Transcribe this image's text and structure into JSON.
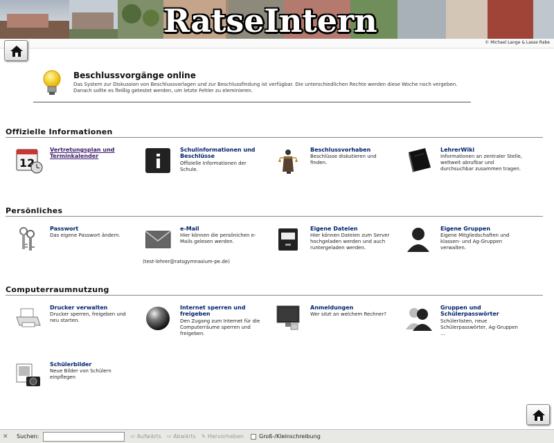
{
  "banner": {
    "title": "RatseIntern",
    "copyright": "© Michael Lange & Lasse Rabe"
  },
  "announcement": {
    "title": "Beschlussvorgänge online",
    "text_1": "Das System zur Diskussion von Beschlussvorlagen und zur Beschlussfindung ist verfügbar. Die unterschiedlichen Rechte werden diese Woche noch vergeben.",
    "text_2": "Danach sollte es fleißig getestet werden, um letzte Fehler zu eleminieren."
  },
  "sections": {
    "official": {
      "title": "Offizielle Informationen",
      "items": [
        {
          "name": "Vertretungsplan und Terminkalender",
          "desc": "",
          "icon": "calendar-icon"
        },
        {
          "name": "Schulinformationen und Beschlüsse",
          "desc": "Offizielle Informationen der Schule.",
          "icon": "info-icon"
        },
        {
          "name": "Beschlussvorhaben",
          "desc": "Beschlüsse diskutieren und finden.",
          "icon": "justitia-icon"
        },
        {
          "name": "LehrerWiki",
          "desc": "Informationen an zentraler Stelle, weltweit abrufbar und durchsuchbar zusammen tragen.",
          "icon": "book-icon"
        }
      ]
    },
    "personal": {
      "title": "Persönliches",
      "items": [
        {
          "name": "Passwort",
          "desc": "Das eigene Passwort ändern.",
          "icon": "keys-icon"
        },
        {
          "name": "e-Mail",
          "desc": "Hier können die persönichen e-Mails gelesen werden.",
          "icon": "envelope-icon"
        },
        {
          "name": "Eigene Dateien",
          "desc": "Hier können Dateien zum Server hochgeladen werden und auch runtergeladen werden.",
          "icon": "file-cabinet-icon"
        },
        {
          "name": "Eigene Gruppen",
          "desc": "Eigene Mitgliedschaften und klassen- und Ag-Gruppen verwalten.",
          "icon": "user-icon"
        }
      ],
      "email_address": "(test-lehrer@ratsgymnasium-pe.de)"
    },
    "computer": {
      "title": "Computerraumnutzung",
      "items": [
        {
          "name": "Drucker verwalten",
          "desc": "Drucker sperren, freigeben und neu starten.",
          "icon": "printer-icon"
        },
        {
          "name": "Internet sperren und freigeben",
          "desc": "Den Zugang zum Internet für die Computerräume sperren und freigeben.",
          "icon": "globe-icon"
        },
        {
          "name": "Anmeldungen",
          "desc": "Wer sitzt an welchem Rechner?",
          "icon": "monitor-icon"
        },
        {
          "name": "Gruppen und Schülerpasswörter",
          "desc": "Schülerlisten, neue Schülerpasswörter, Ag-Gruppen ...",
          "icon": "users-icon"
        },
        {
          "name": "Schülerbilder",
          "desc": "Neue Bilder von Schülern einpflegen",
          "icon": "camera-icon"
        }
      ]
    }
  },
  "findbar": {
    "close": "✕",
    "label": "Suchen:",
    "value": "",
    "next": "Aufwärts",
    "prev": "Abwärts",
    "highlight": "Hervorheben",
    "match_case": "Groß-/Kleinschreibung"
  },
  "colors": {
    "link": "#00226a",
    "visited_link": "#3a1c6a"
  }
}
